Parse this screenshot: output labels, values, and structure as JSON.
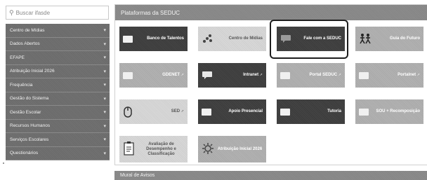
{
  "search": {
    "placeholder": "Buscar ifasde"
  },
  "sidebar": {
    "items": [
      {
        "label": "Centro de Mídias"
      },
      {
        "label": "Dados Abertos"
      },
      {
        "label": "EFAPE"
      },
      {
        "label": "Atribuição Inicial 2026"
      },
      {
        "label": "Frequência"
      },
      {
        "label": "Gestão do Sistema"
      },
      {
        "label": "Gestão Escolar"
      },
      {
        "label": "Recursos Humanos"
      },
      {
        "label": "Serviços Escolares"
      },
      {
        "label": "Questionários"
      }
    ]
  },
  "platforms": {
    "title": "Plataformas da SEDUC",
    "tiles": [
      {
        "label": "Banco de Talentos",
        "icon": "square-icon"
      },
      {
        "label": "Centro de Mídias",
        "icon": "dots-icon"
      },
      {
        "label": "Fale com a SEDUC",
        "icon": "chat-icon"
      },
      {
        "label": "Guia do Futuro",
        "icon": "people-icon"
      },
      {
        "label": "GDENET",
        "icon": "square-icon"
      },
      {
        "label": "Intranet",
        "icon": "chat-icon"
      },
      {
        "label": "Portal SEDUC",
        "icon": "square-icon"
      },
      {
        "label": "Portalnet",
        "icon": "square-icon"
      },
      {
        "label": "SED",
        "icon": "mouse-icon"
      },
      {
        "label": "Apoio Presencial",
        "icon": "square-icon"
      },
      {
        "label": "Tutoria",
        "icon": "square-icon"
      },
      {
        "label": "SOU + Recomposição",
        "icon": "square-icon"
      },
      {
        "label": "Avaliação de Desempenho e Classificação",
        "icon": "clipboard-icon"
      },
      {
        "label": "Atribuição Inicial 2026",
        "icon": "gear-icon"
      }
    ]
  },
  "news": {
    "title": "Mural de Avisos"
  }
}
